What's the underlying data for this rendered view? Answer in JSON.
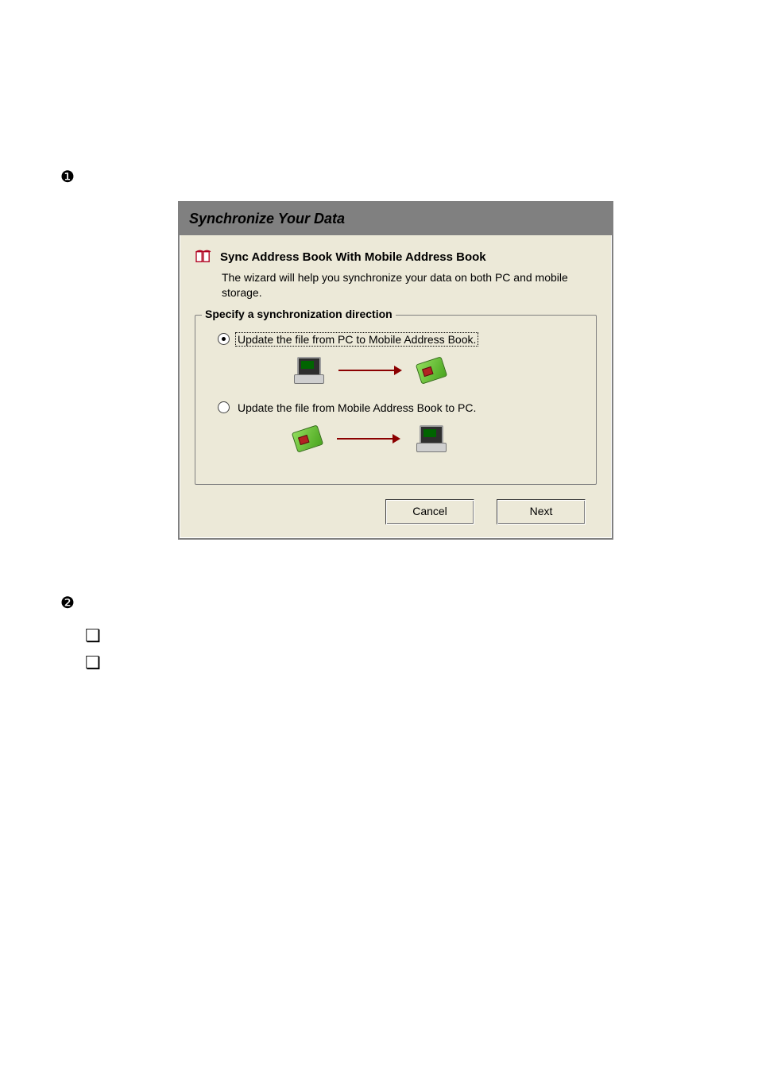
{
  "wizard": {
    "title": "Synchronize Your Data",
    "section_title": "Sync Address Book With Mobile Address Book",
    "section_desc": "The wizard will help you synchronize your data on both PC and mobile storage.",
    "fieldset_legend": "Specify a synchronization direction",
    "option1": "Update the file from PC to Mobile Address Book.",
    "option2": "Update the file from Mobile Address Book to PC.",
    "selected_option": 1,
    "cancel_label": "Cancel",
    "next_label": "Next"
  },
  "markers": {
    "b1": "❶",
    "b2": "❷",
    "cb": "❏"
  }
}
